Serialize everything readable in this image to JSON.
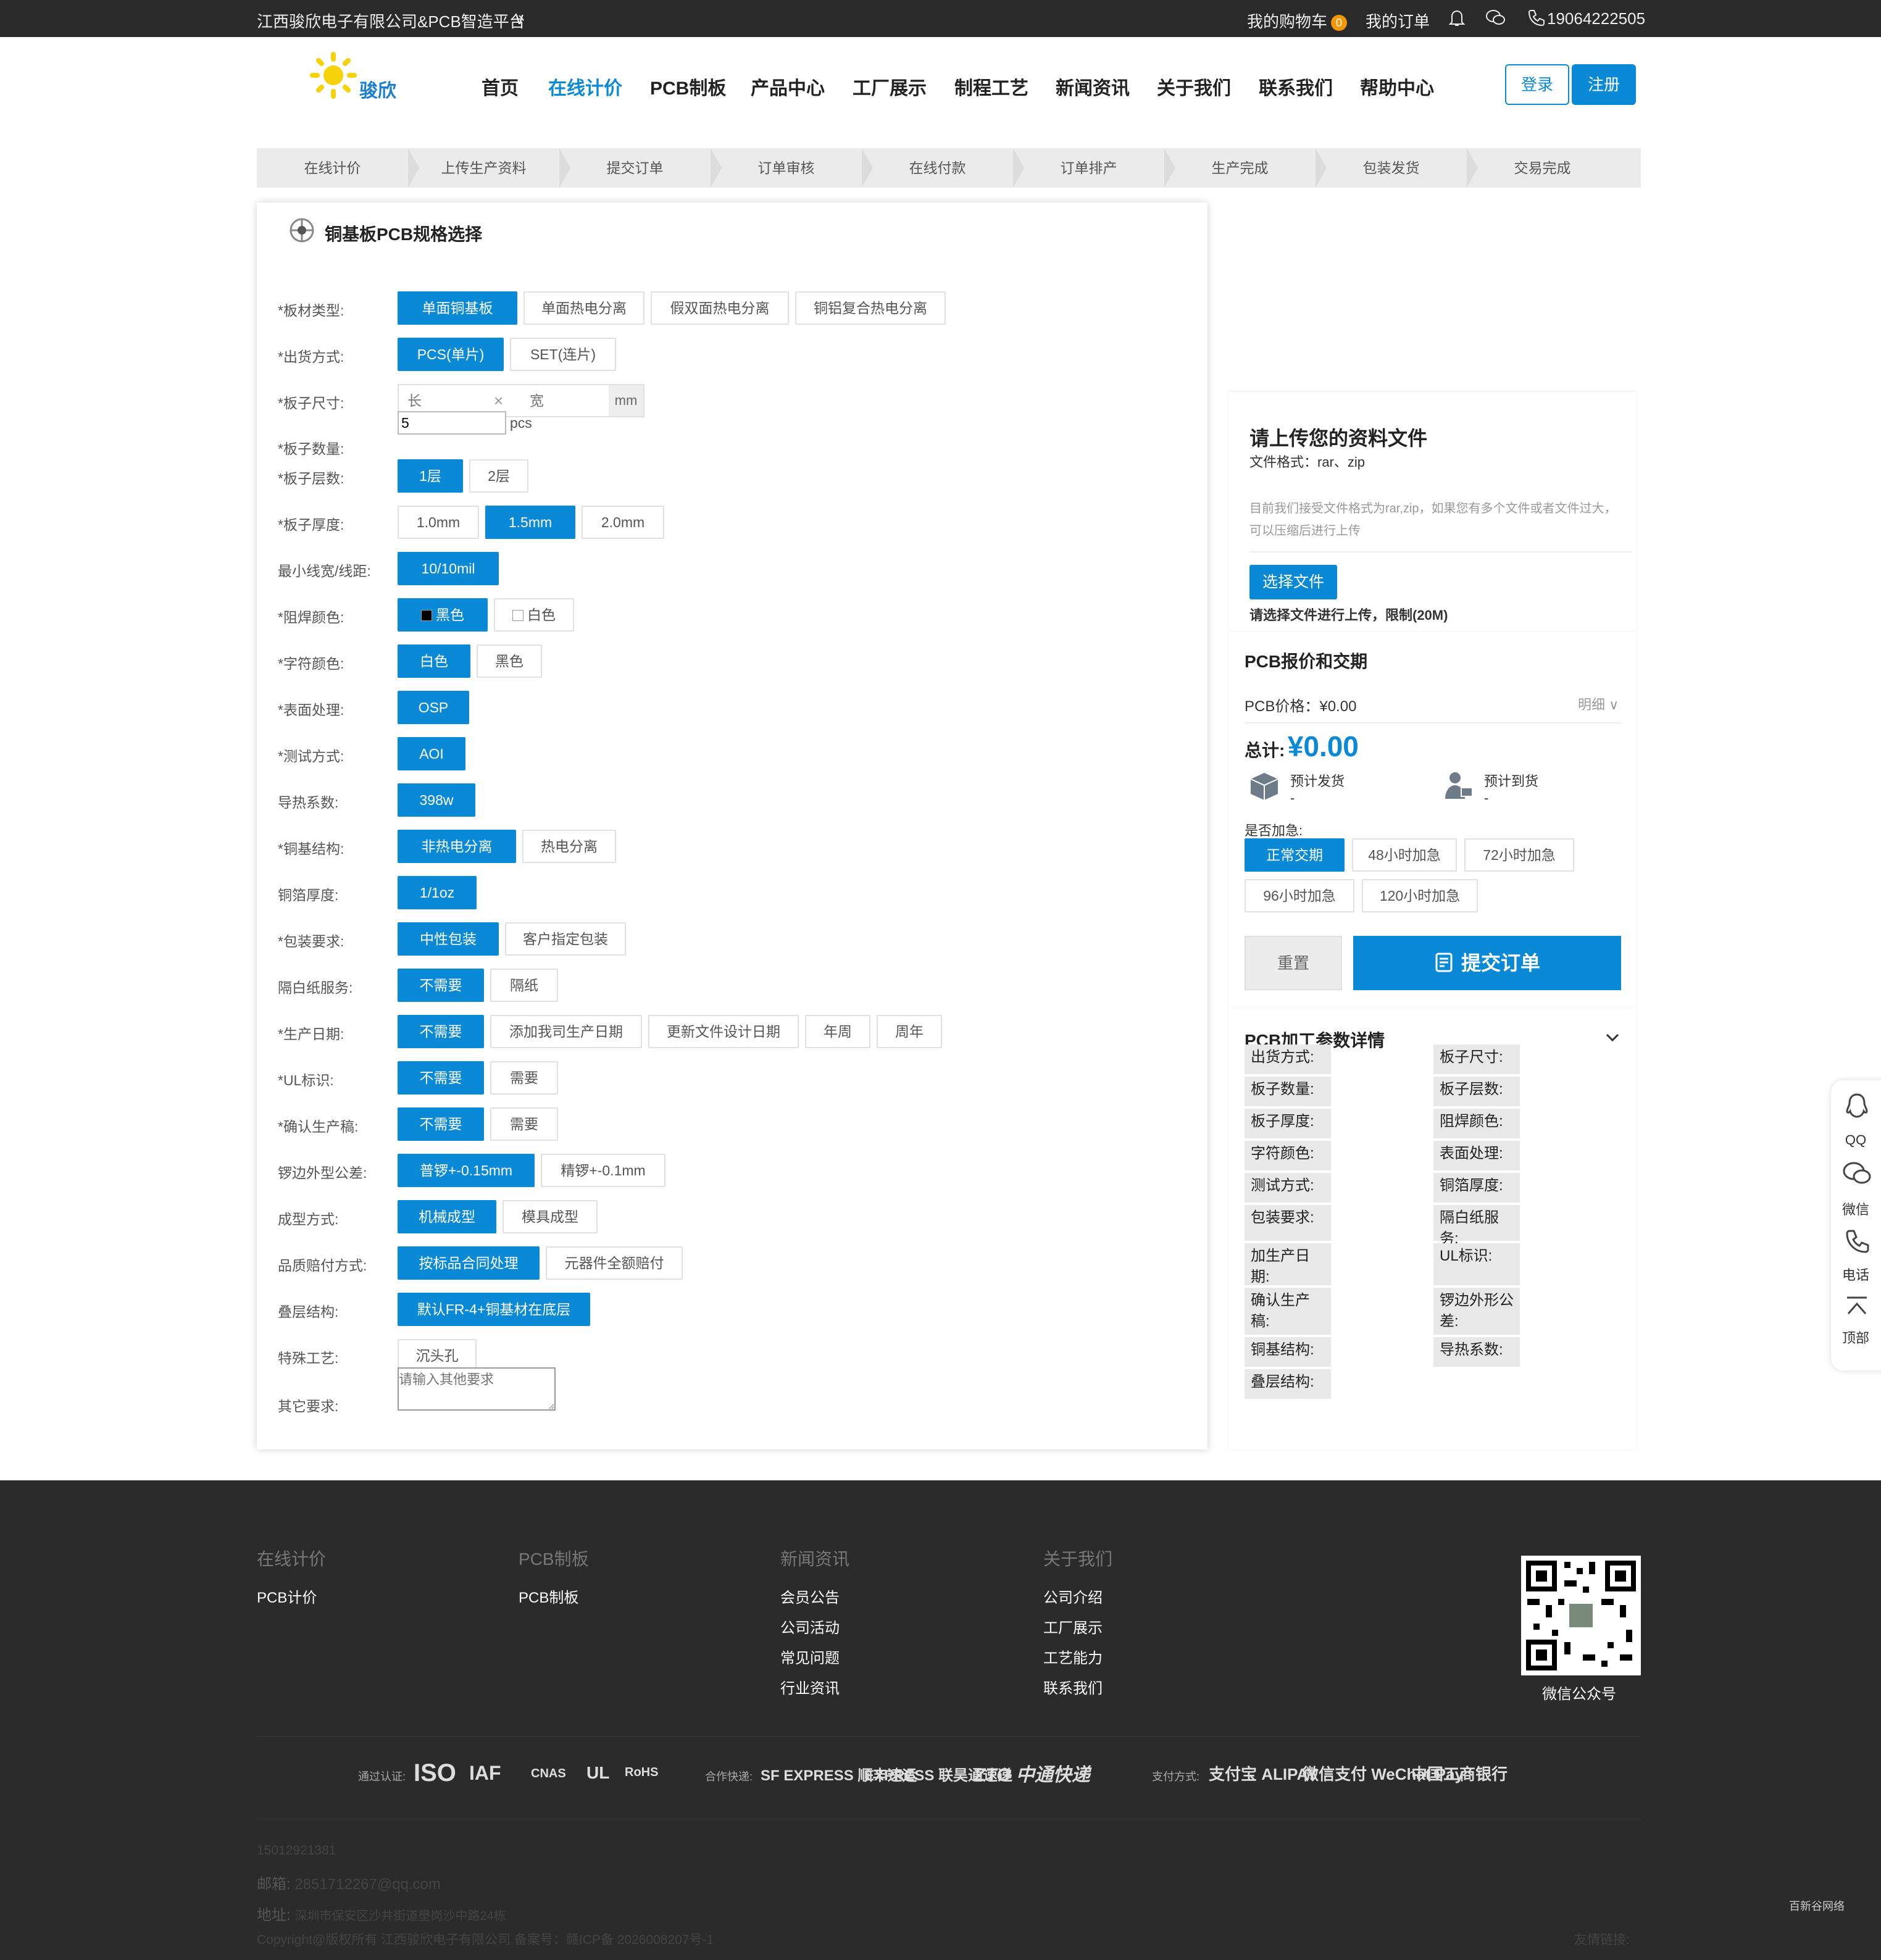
{
  "topbar": {
    "company": "江西骏欣电子有限公司&PCB智造平台",
    "cart": "我的购物车",
    "cart_count": "0",
    "orders": "我的订单",
    "phone": "19064222505"
  },
  "logo": {
    "text": "骏欣"
  },
  "nav": {
    "items": [
      "首页",
      "在线计价",
      "PCB制板",
      "产品中心",
      "工厂展示",
      "制程工艺",
      "新闻资讯",
      "关于我们",
      "联系我们",
      "帮助中心"
    ],
    "login": "登录",
    "register": "注册"
  },
  "steps": [
    "在线计价",
    "上传生产资料",
    "提交订单",
    "订单审核",
    "在线付款",
    "订单排产",
    "生产完成",
    "包装发货",
    "交易完成"
  ],
  "form": {
    "title": "铜基板PCB规格选择",
    "size_len_placeholder": "长",
    "size_wid_placeholder": "宽",
    "size_unit": "mm",
    "size_times": "×",
    "qty_value": "5",
    "qty_unit": "pcs",
    "other_placeholder": "请输入其他要求",
    "rows": [
      {
        "label": "*板材类型:",
        "options": [
          "单面铜基板",
          "单面热电分离",
          "假双面热电分离",
          "铜铝复合热电分离"
        ]
      },
      {
        "label": "*出货方式:",
        "options": [
          "PCS(单片)",
          "SET(连片)"
        ]
      },
      {
        "label": "*板子尺寸:"
      },
      {
        "label": "*板子数量:"
      },
      {
        "label": "*板子层数:",
        "options": [
          "1层",
          "2层"
        ]
      },
      {
        "label": "*板子厚度:",
        "options": [
          "1.0mm",
          "1.5mm",
          "2.0mm"
        ]
      },
      {
        "label": "最小线宽/线距:",
        "options": [
          "10/10mil"
        ]
      },
      {
        "label": "*阻焊颜色:",
        "options": [
          "黑色",
          "白色"
        ]
      },
      {
        "label": "*字符颜色:",
        "options": [
          "白色",
          "黑色"
        ]
      },
      {
        "label": "*表面处理:",
        "options": [
          "OSP"
        ]
      },
      {
        "label": "*测试方式:",
        "options": [
          "AOI"
        ]
      },
      {
        "label": "导热系数:",
        "options": [
          "398w"
        ]
      },
      {
        "label": "*铜基结构:",
        "options": [
          "非热电分离",
          "热电分离"
        ]
      },
      {
        "label": "铜箔厚度:",
        "options": [
          "1/1oz"
        ]
      },
      {
        "label": "*包装要求:",
        "options": [
          "中性包装",
          "客户指定包装"
        ]
      },
      {
        "label": "隔白纸服务:",
        "options": [
          "不需要",
          "隔纸"
        ]
      },
      {
        "label": "*生产日期:",
        "options": [
          "不需要",
          "添加我司生产日期",
          "更新文件设计日期",
          "年周",
          "周年"
        ]
      },
      {
        "label": "*UL标识:",
        "options": [
          "不需要",
          "需要"
        ]
      },
      {
        "label": "*确认生产稿:",
        "options": [
          "不需要",
          "需要"
        ]
      },
      {
        "label": "锣边外型公差:",
        "options": [
          "普锣+-0.15mm",
          "精锣+-0.1mm"
        ]
      },
      {
        "label": "成型方式:",
        "options": [
          "机械成型",
          "模具成型"
        ]
      },
      {
        "label": "品质赔付方式:",
        "options": [
          "按标品合同处理",
          "元器件全额赔付"
        ]
      },
      {
        "label": "叠层结构:",
        "options": [
          "默认FR-4+铜基材在底层"
        ]
      },
      {
        "label": "特殊工艺:",
        "options": [
          "沉头孔"
        ]
      },
      {
        "label": "其它要求:"
      }
    ]
  },
  "upload": {
    "title": "请上传您的资料文件",
    "format": "文件格式：rar、zip",
    "note1": "目前我们接受文件格式为rar,zip，如果您有多个文件或者文件过大，",
    "note2": "可以压缩后进行上传",
    "button": "选择文件",
    "hint": "请选择文件进行上传，限制(20M)"
  },
  "quote": {
    "title": "PCB报价和交期",
    "price_label": "PCB价格：",
    "price": "¥0.00",
    "detail": "明细",
    "total_label": "总计:",
    "total": "¥0.00",
    "ship_label": "预计发货",
    "ship_val": "-",
    "arrive_label": "预计到货",
    "arrive_val": "-",
    "urgent_label": "是否加急:",
    "urgent": [
      "正常交期",
      "48小时加急",
      "72小时加急",
      "96小时加急",
      "120小时加急"
    ],
    "reset": "重置",
    "submit": "提交订单"
  },
  "params": {
    "title": "PCB加工参数详情",
    "left": [
      "出货方式:",
      "板子数量:",
      "板子厚度:",
      "字符颜色:",
      "测试方式:",
      "包装要求:",
      "加生产日期:",
      "确认生产稿:",
      "铜基结构:",
      "叠层结构:"
    ],
    "right": [
      "板子尺寸:",
      "板子层数:",
      "阻焊颜色:",
      "表面处理:",
      "铜箔厚度:",
      "隔白纸服务:",
      "UL标识:",
      "锣边外形公差:",
      "导热系数:"
    ]
  },
  "floatbar": [
    "QQ",
    "微信",
    "电话",
    "顶部"
  ],
  "footer": {
    "cols": [
      {
        "head": "在线计价",
        "links": [
          "PCB计价"
        ]
      },
      {
        "head": "PCB制板",
        "links": [
          "PCB制板"
        ]
      },
      {
        "head": "新闻资讯",
        "links": [
          "会员公告",
          "公司活动",
          "常见问题",
          "行业资讯"
        ]
      },
      {
        "head": "关于我们",
        "links": [
          "公司介绍",
          "工厂展示",
          "工艺能力",
          "联系我们"
        ]
      }
    ],
    "qr_label": "微信公众号",
    "cert_label": "通过认证:",
    "certs": [
      "ISO",
      "IAF",
      "CNAS",
      "UL",
      "RoHS"
    ],
    "ship_label": "合作快递:",
    "couriers": [
      "SF EXPRESS 顺丰速运",
      "EXPRESS 联昊通速递",
      "ZTO 中通快递"
    ],
    "pay_label": "支付方式:",
    "pays": [
      "支付宝 ALIPAY",
      "微信支付 WeChat Pay",
      "中国工商银行"
    ],
    "tel": "15012921381",
    "email_label": "邮箱:",
    "email": "2851712267@qq.com",
    "addr_label": "地址:",
    "addr": "深圳市保安区沙井街道壆岗沙中路24栋",
    "copyright": "Copyright@版权所有 江西骏欣电子有限公司 备案号：赣ICP备 2026008207号-1",
    "friend": "友情链接:",
    "corner": "百新谷网络"
  }
}
